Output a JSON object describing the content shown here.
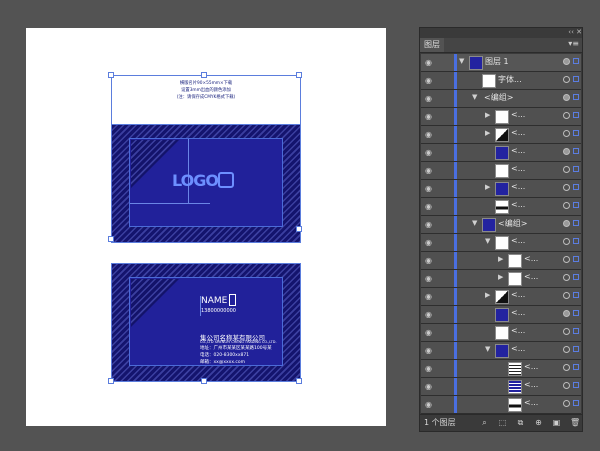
{
  "panel": {
    "title": "图层",
    "collapse_glyph": "‹‹ ✕",
    "menu_glyph": "▾≡",
    "layer_count": "1 个图层",
    "layers": [
      {
        "name": "图层 1",
        "depth": 0,
        "twirl": "▼",
        "thumb": "blue",
        "target": "filled"
      },
      {
        "name": "字体...",
        "depth": 1,
        "twirl": "",
        "thumb": "white",
        "target": "empty"
      },
      {
        "name": "<编组>",
        "depth": 1,
        "twirl": "▼",
        "thumb": "none",
        "target": "filled"
      },
      {
        "name": "<...",
        "depth": 2,
        "twirl": "▶",
        "thumb": "white",
        "target": "empty"
      },
      {
        "name": "<...",
        "depth": 2,
        "twirl": "▶",
        "thumb": "mixed",
        "target": "empty"
      },
      {
        "name": "<...",
        "depth": 2,
        "twirl": "",
        "thumb": "blue",
        "target": "filled"
      },
      {
        "name": "<...",
        "depth": 2,
        "twirl": "",
        "thumb": "white",
        "target": "empty"
      },
      {
        "name": "<...",
        "depth": 2,
        "twirl": "▶",
        "thumb": "blue",
        "target": "empty"
      },
      {
        "name": "<...",
        "depth": 2,
        "twirl": "",
        "thumb": "dark",
        "target": "empty"
      },
      {
        "name": "<编组>",
        "depth": 1,
        "twirl": "▼",
        "thumb": "blue",
        "target": "filled"
      },
      {
        "name": "<...",
        "depth": 2,
        "twirl": "▼",
        "thumb": "white",
        "target": "empty"
      },
      {
        "name": "<...",
        "depth": 3,
        "twirl": "▶",
        "thumb": "dice",
        "target": "empty"
      },
      {
        "name": "<...",
        "depth": 3,
        "twirl": "▶",
        "thumb": "white",
        "target": "empty"
      },
      {
        "name": "<...",
        "depth": 2,
        "twirl": "▶",
        "thumb": "mixed",
        "target": "empty"
      },
      {
        "name": "<...",
        "depth": 2,
        "twirl": "",
        "thumb": "blue",
        "target": "filled"
      },
      {
        "name": "<...",
        "depth": 2,
        "twirl": "",
        "thumb": "white",
        "target": "empty"
      },
      {
        "name": "<...",
        "depth": 2,
        "twirl": "▼",
        "thumb": "blue",
        "target": "empty"
      },
      {
        "name": "<...",
        "depth": 3,
        "twirl": "",
        "thumb": "lines",
        "target": "empty"
      },
      {
        "name": "<...",
        "depth": 3,
        "twirl": "",
        "thumb": "bluelines",
        "target": "empty"
      },
      {
        "name": "<...",
        "depth": 3,
        "twirl": "",
        "thumb": "dark",
        "target": "empty"
      }
    ],
    "footer_icons": [
      "search-icon",
      "collect-export-icon",
      "make-clipping-mask-icon",
      "new-sublayer-icon",
      "new-layer-icon",
      "delete-icon"
    ],
    "footer_glyphs": [
      "⌕",
      "⬚",
      "⧉",
      "⊕",
      "▣",
      "🗑"
    ]
  },
  "artboard": {
    "note_line1": "横版名片90×55mm×下载",
    "note_line2": "设置3mm出血的颜色添加",
    "note_line3": "(注：请保存成CMYK格式下载)"
  },
  "card_back": {
    "logo_text": "LOGO"
  },
  "card_front": {
    "name": "NAME",
    "phone": "13800000000",
    "company": "集公司名称某有限公司",
    "company_en": "CO.,LTD SHENGYI CHENG TRADING CO.,LTD.",
    "addr": "地址：广州市某某区某某路100号某",
    "tel": "电话：020-8300xx871",
    "mail": "邮箱：xx@xxxx.com"
  },
  "colors": {
    "accent": "#5b7ddd",
    "card_navy": "#21219a",
    "stripe": "#3b3fa0"
  }
}
